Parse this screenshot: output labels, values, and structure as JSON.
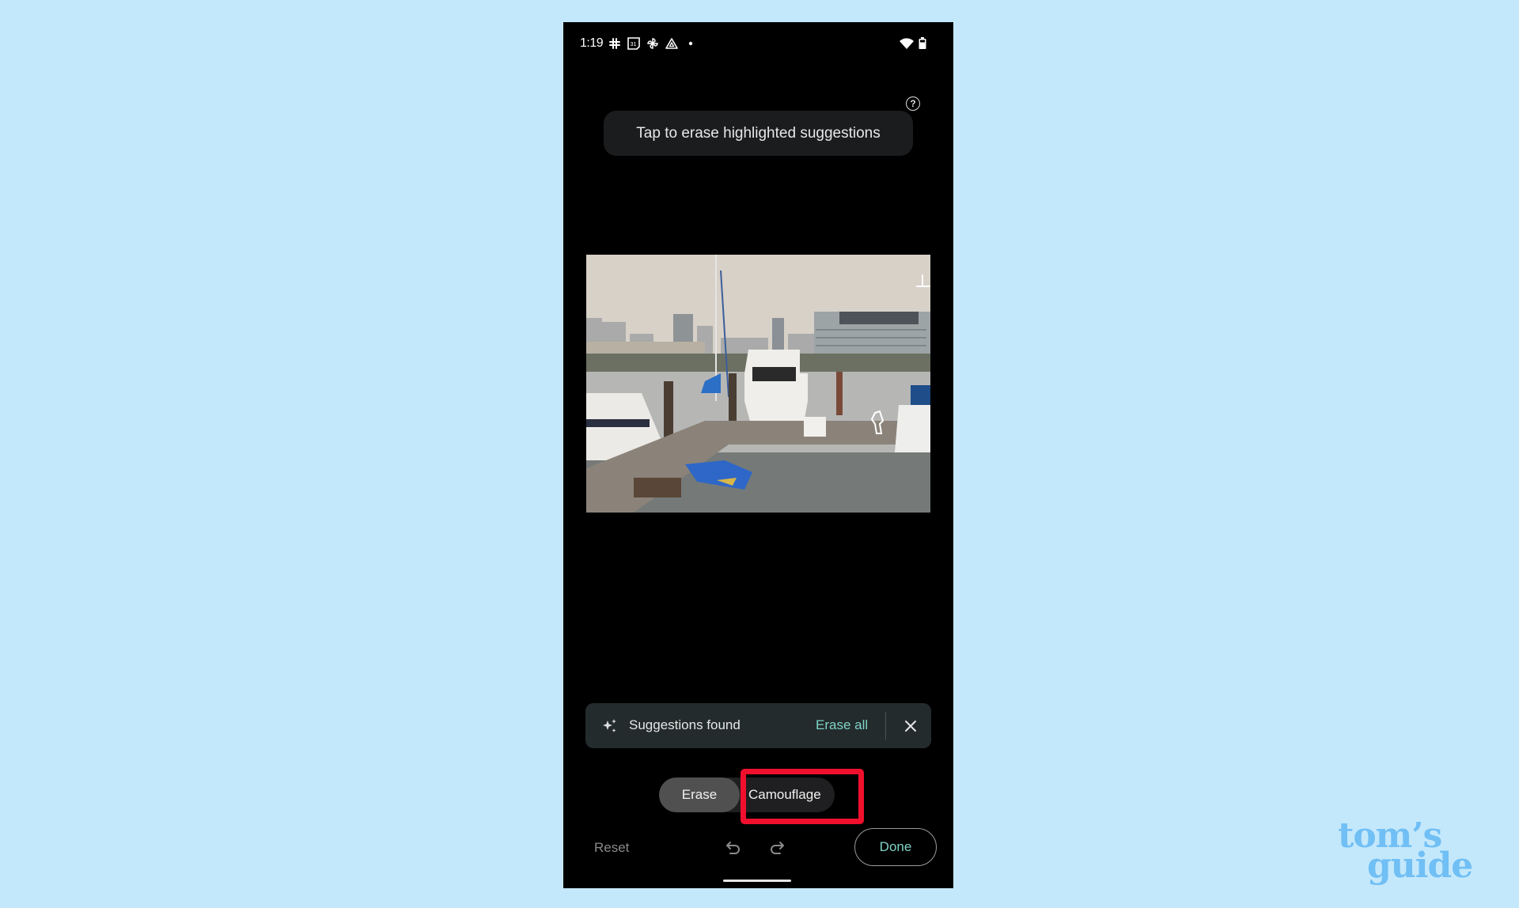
{
  "status_bar": {
    "time": "1:19",
    "notification_icons": [
      "slack-icon",
      "calendar-icon",
      "pinwheel-icon",
      "drive-icon",
      "dot-icon"
    ],
    "calendar_day": "31",
    "system_icons": [
      "wifi-icon",
      "battery-icon"
    ]
  },
  "editor": {
    "help_icon": "help-icon",
    "hint_text": "Tap to erase highlighted suggestions",
    "photo_description": "Marina with boats docked and city skyline in background"
  },
  "suggestions_bar": {
    "icon": "sparkle-icon",
    "label": "Suggestions found",
    "erase_all_label": "Erase all",
    "close_icon": "close-icon",
    "accent_color": "#7fd3c6"
  },
  "mode_toggle": {
    "options": [
      {
        "label": "Erase",
        "selected": true
      },
      {
        "label": "Camouflage",
        "selected": false
      }
    ],
    "highlight_color": "#f0102d"
  },
  "bottom_bar": {
    "reset_label": "Reset",
    "undo_icon": "undo-icon",
    "redo_icon": "redo-icon",
    "done_label": "Done"
  },
  "watermark": {
    "line1": "tom’s",
    "line2": "guide"
  }
}
